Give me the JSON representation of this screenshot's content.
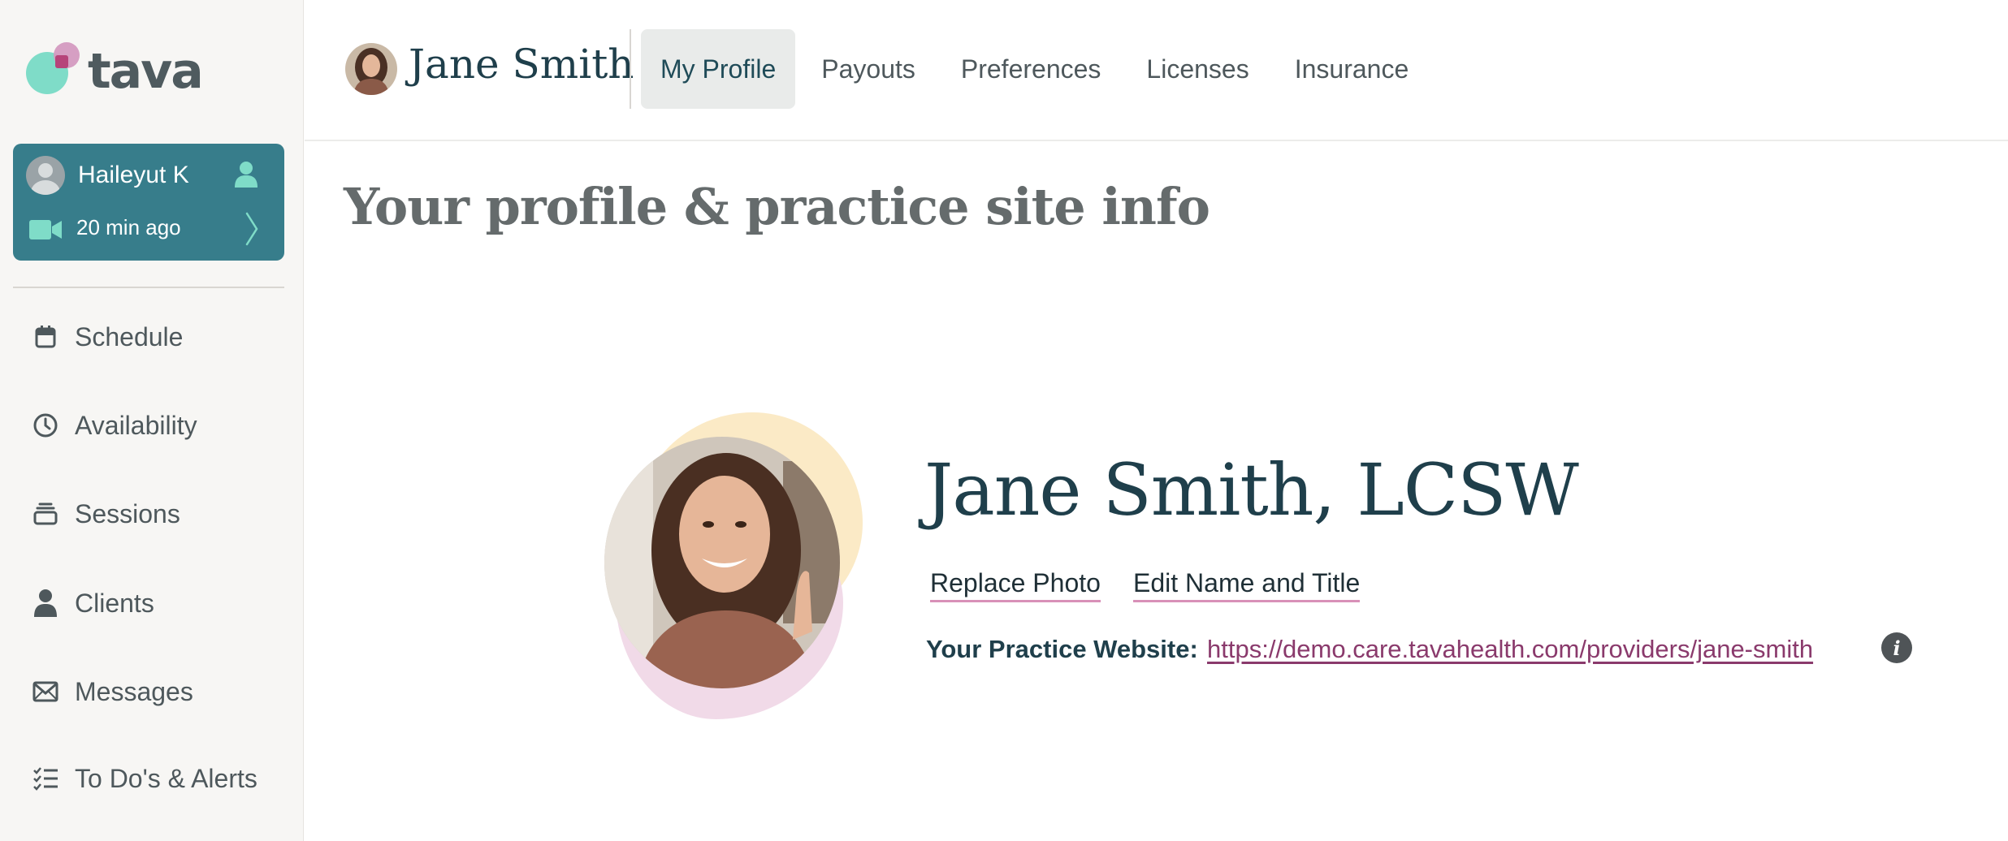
{
  "logo": {
    "text": "tava"
  },
  "active_session": {
    "client_name": "Haileyut K",
    "time_ago": "20 min ago",
    "icons": [
      "avatar",
      "person-icon",
      "video-icon",
      "chevron-right-icon"
    ]
  },
  "sidebar": {
    "items": [
      {
        "label": "Schedule",
        "icon": "calendar-icon"
      },
      {
        "label": "Availability",
        "icon": "clock-icon"
      },
      {
        "label": "Sessions",
        "icon": "stack-icon"
      },
      {
        "label": "Clients",
        "icon": "person-icon"
      },
      {
        "label": "Messages",
        "icon": "envelope-icon"
      },
      {
        "label": "To Do's & Alerts",
        "icon": "checklist-icon"
      }
    ]
  },
  "header": {
    "user_name": "Jane Smith",
    "tabs": [
      {
        "label": "My Profile",
        "active": true
      },
      {
        "label": "Payouts",
        "active": false
      },
      {
        "label": "Preferences",
        "active": false
      },
      {
        "label": "Licenses",
        "active": false
      },
      {
        "label": "Insurance",
        "active": false
      }
    ]
  },
  "main": {
    "title": "Your profile & practice site info",
    "display_name": "Jane Smith, LCSW",
    "replace_photo_label": "Replace Photo",
    "edit_name_label": "Edit Name and Title",
    "website_label": "Your Practice Website:",
    "website_url": "https://demo.care.tavahealth.com/providers/jane-smith",
    "info_icon_glyph": "i"
  },
  "colors": {
    "active_card": "#377d8b",
    "brand_teal": "#7fdcc8",
    "brand_pink": "#d49ac0",
    "link": "#8a3a6c",
    "heading": "#1f3f4b"
  }
}
